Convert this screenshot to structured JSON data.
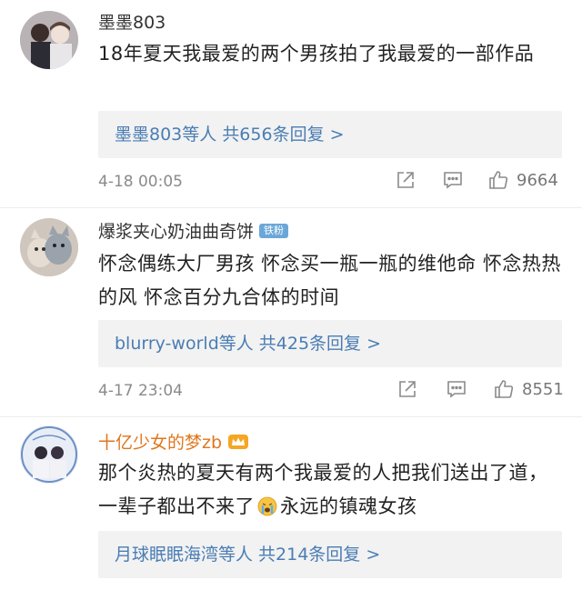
{
  "comments": [
    {
      "username": "墨墨803",
      "text": "18年夏天我最爱的两个男孩拍了我最爱的一部作品",
      "reply_summary": "墨墨803等人 共656条回复 >",
      "time": "4-18 00:05",
      "likes": "9664"
    },
    {
      "username": "爆浆夹心奶油曲奇饼",
      "badge": "铁粉",
      "text": "怀念偶练大厂男孩 怀念买一瓶一瓶的维他命 怀念热热的风 怀念百分九合体的时间",
      "reply_summary": "blurry-world等人 共425条回复 >",
      "time": "4-17 23:04",
      "likes": "8551"
    },
    {
      "username": "十亿少女的梦zb",
      "text_before": "那个炎热的夏天有两个我最爱的人把我们送出了道，一辈子都出不来了",
      "text_after": "永远的镇魂女孩",
      "reply_summary": "月球眠眠海湾等人 共214条回复 >"
    }
  ],
  "colors": {
    "reply_link": "#4a7db4",
    "gold_name": "#e0761c",
    "meta_gray": "#8a8a8a",
    "reply_bg": "#f2f2f2"
  }
}
